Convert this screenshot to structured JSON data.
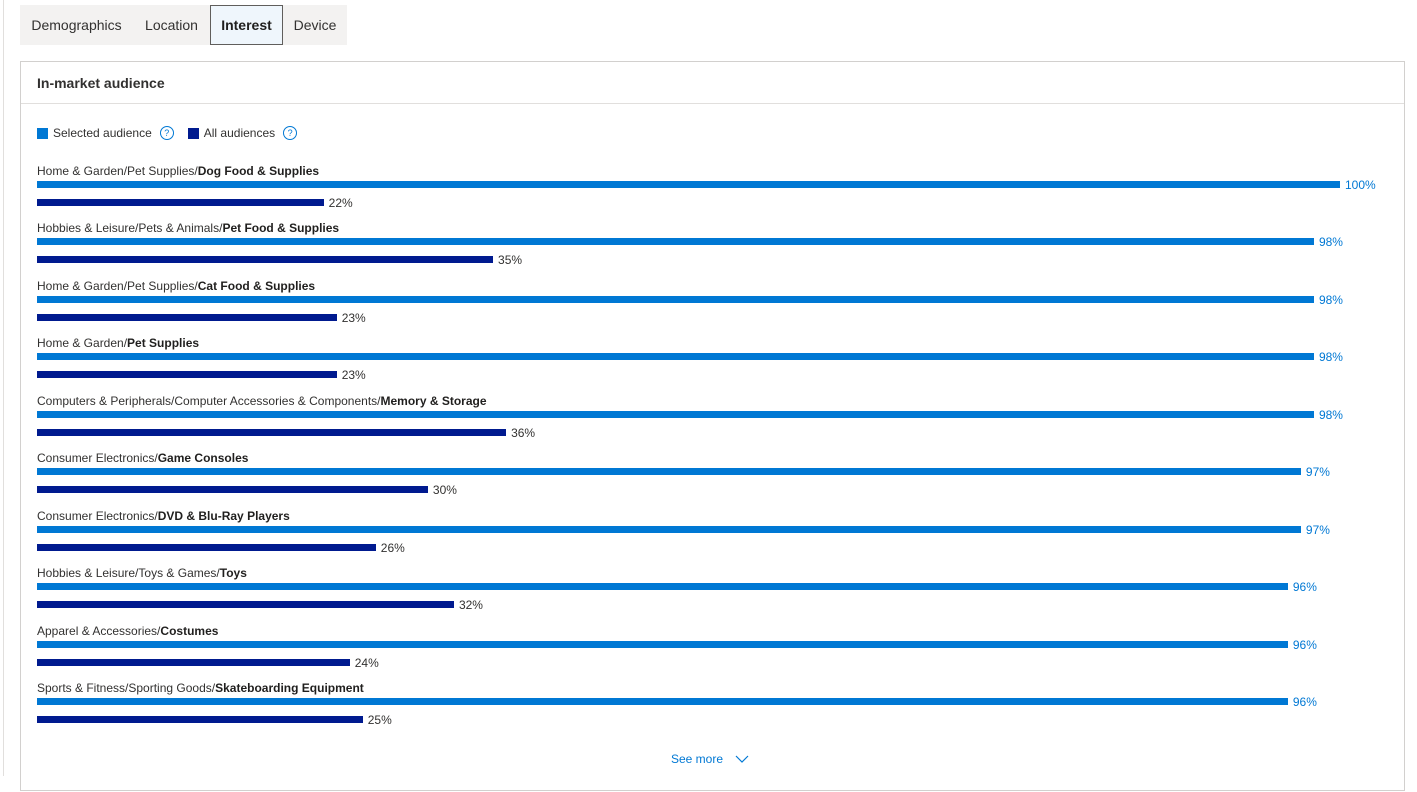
{
  "tabs": [
    {
      "label": "Demographics",
      "selected": false
    },
    {
      "label": "Location",
      "selected": false
    },
    {
      "label": "Interest",
      "selected": true
    },
    {
      "label": "Device",
      "selected": false
    }
  ],
  "card": {
    "title": "In-market audience",
    "see_more_label": "See more"
  },
  "colors": {
    "selected_audience": "#0078d4",
    "all_audiences": "#001a8f"
  },
  "chart_data": {
    "type": "bar",
    "orientation": "horizontal",
    "title": "In-market audience",
    "xlim": [
      0,
      100
    ],
    "unit": "%",
    "legend": {
      "position": "top-left",
      "entries": [
        "Selected audience",
        "All audiences"
      ]
    },
    "categories": [
      {
        "prefix": "Home & Garden/Pet Supplies/",
        "leaf": "Dog Food & Supplies"
      },
      {
        "prefix": "Hobbies & Leisure/Pets & Animals/",
        "leaf": "Pet Food & Supplies"
      },
      {
        "prefix": "Home & Garden/Pet Supplies/",
        "leaf": "Cat Food & Supplies"
      },
      {
        "prefix": "Home & Garden/",
        "leaf": "Pet Supplies"
      },
      {
        "prefix": "Computers & Peripherals/Computer Accessories & Components/",
        "leaf": "Memory & Storage"
      },
      {
        "prefix": "Consumer Electronics/",
        "leaf": "Game Consoles"
      },
      {
        "prefix": "Consumer Electronics/",
        "leaf": "DVD & Blu-Ray Players"
      },
      {
        "prefix": "Hobbies & Leisure/Toys & Games/",
        "leaf": "Toys"
      },
      {
        "prefix": "Apparel & Accessories/",
        "leaf": "Costumes"
      },
      {
        "prefix": "Sports & Fitness/Sporting Goods/",
        "leaf": "Skateboarding Equipment"
      }
    ],
    "series": [
      {
        "name": "Selected audience",
        "values": [
          100,
          98,
          98,
          98,
          98,
          97,
          97,
          96,
          96,
          96
        ]
      },
      {
        "name": "All audiences",
        "values": [
          22,
          35,
          23,
          23,
          36,
          30,
          26,
          32,
          24,
          25
        ]
      }
    ]
  }
}
